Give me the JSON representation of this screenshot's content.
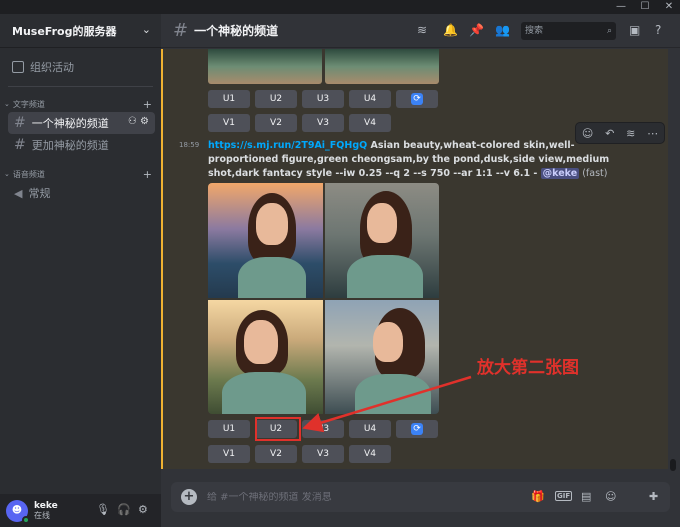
{
  "server": {
    "name": "MuseFrog的服务器"
  },
  "sidebar": {
    "events_label": "组织活动",
    "categories": [
      {
        "label": "文字频道"
      },
      {
        "label": "语音频道"
      }
    ],
    "channels": [
      {
        "label": "一个神秘的频道"
      },
      {
        "label": "更加神秘的频道"
      },
      {
        "label": "常规"
      }
    ]
  },
  "user": {
    "name": "keke",
    "status": "在线"
  },
  "header": {
    "channel_title": "一个神秘的频道",
    "search_placeholder": "搜索"
  },
  "message": {
    "time": "18:59",
    "link": "https://s.mj.run/2T9Ai_FQHgQ",
    "prompt": " Asian beauty,wheat-colored skin,well-proportioned figure,green cheongsam,by the pond,dusk,side view,medium shot,dark fantacy style --iw 0.25 --q 2 --s 750 --ar 1:1 --v 6.1 - ",
    "mention": "@keke",
    "mode": " (fast)"
  },
  "buttons": {
    "upscale": [
      "U1",
      "U2",
      "U3",
      "U4"
    ],
    "variation": [
      "V1",
      "V2",
      "V3",
      "V4"
    ]
  },
  "annotation": {
    "text": "放大第二张图"
  },
  "composer": {
    "placeholder": "给 #一个神秘的频道 发消息"
  },
  "colors": {
    "highlight": "#f0b232",
    "annotation": "#e0312b",
    "link": "#00a8fc",
    "status_online": "#23a55a"
  }
}
